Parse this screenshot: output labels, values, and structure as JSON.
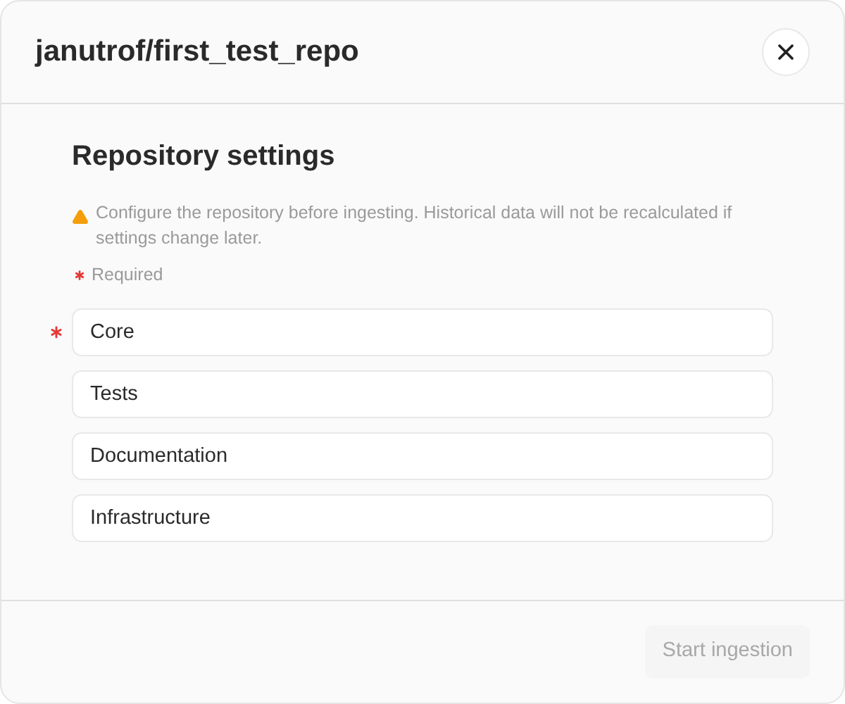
{
  "dialog": {
    "title": "janutrof/first_test_repo"
  },
  "section": {
    "heading": "Repository settings",
    "warning": "Configure the repository before ingesting. Historical data will not be recalculated if settings change later.",
    "required_legend": "Required"
  },
  "fields": [
    {
      "value": "Core",
      "required": true
    },
    {
      "value": "Tests",
      "required": false
    },
    {
      "value": "Documentation",
      "required": false
    },
    {
      "value": "Infrastructure",
      "required": false
    }
  ],
  "footer": {
    "button": {
      "label": "Start ingestion",
      "disabled": true
    }
  }
}
